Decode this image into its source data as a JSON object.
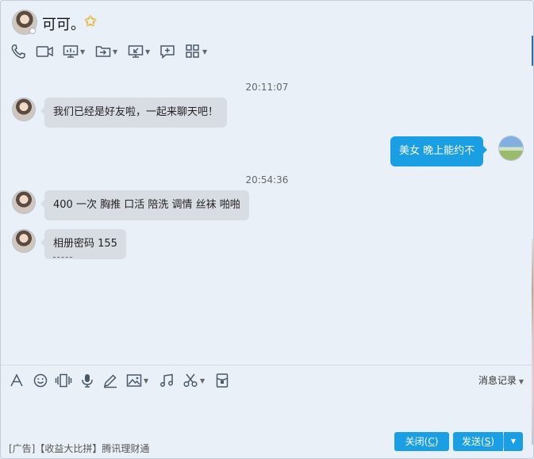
{
  "contact": {
    "name": "可可。"
  },
  "messages": [
    {
      "type": "timestamp",
      "text": "20:11:07"
    },
    {
      "type": "in",
      "text": "我们已经是好友啦，一起来聊天吧！"
    },
    {
      "type": "out",
      "text": "美女  晚上能约不"
    },
    {
      "type": "timestamp",
      "text": "20:54:36"
    },
    {
      "type": "in",
      "text": "400  一次 胸推 口活 陪洗 调情 丝袜 啪啪"
    },
    {
      "type": "in",
      "text": "相册密码 155"
    }
  ],
  "input": {
    "history_label": "消息记录"
  },
  "footer": {
    "ad_text": "[广告]【收益大比拼】腾讯理财通",
    "close_label": "关闭",
    "close_hotkey": "C",
    "send_label": "发送",
    "send_hotkey": "S"
  },
  "colors": {
    "accent": "#1a9fe5",
    "background": "#eaf0f8",
    "incoming_bubble": "#d8dde4"
  },
  "icons": {
    "header_toolbar": [
      "phone-icon",
      "video-call-icon",
      "screen-share-icon",
      "file-transfer-icon",
      "remote-desktop-icon",
      "new-discussion-icon",
      "apps-grid-icon"
    ],
    "input_toolbar": [
      "font-icon",
      "emoji-icon",
      "shake-icon",
      "voice-message-icon",
      "handwriting-icon",
      "image-icon",
      "music-icon",
      "screenshot-icon",
      "red-packet-icon"
    ]
  }
}
